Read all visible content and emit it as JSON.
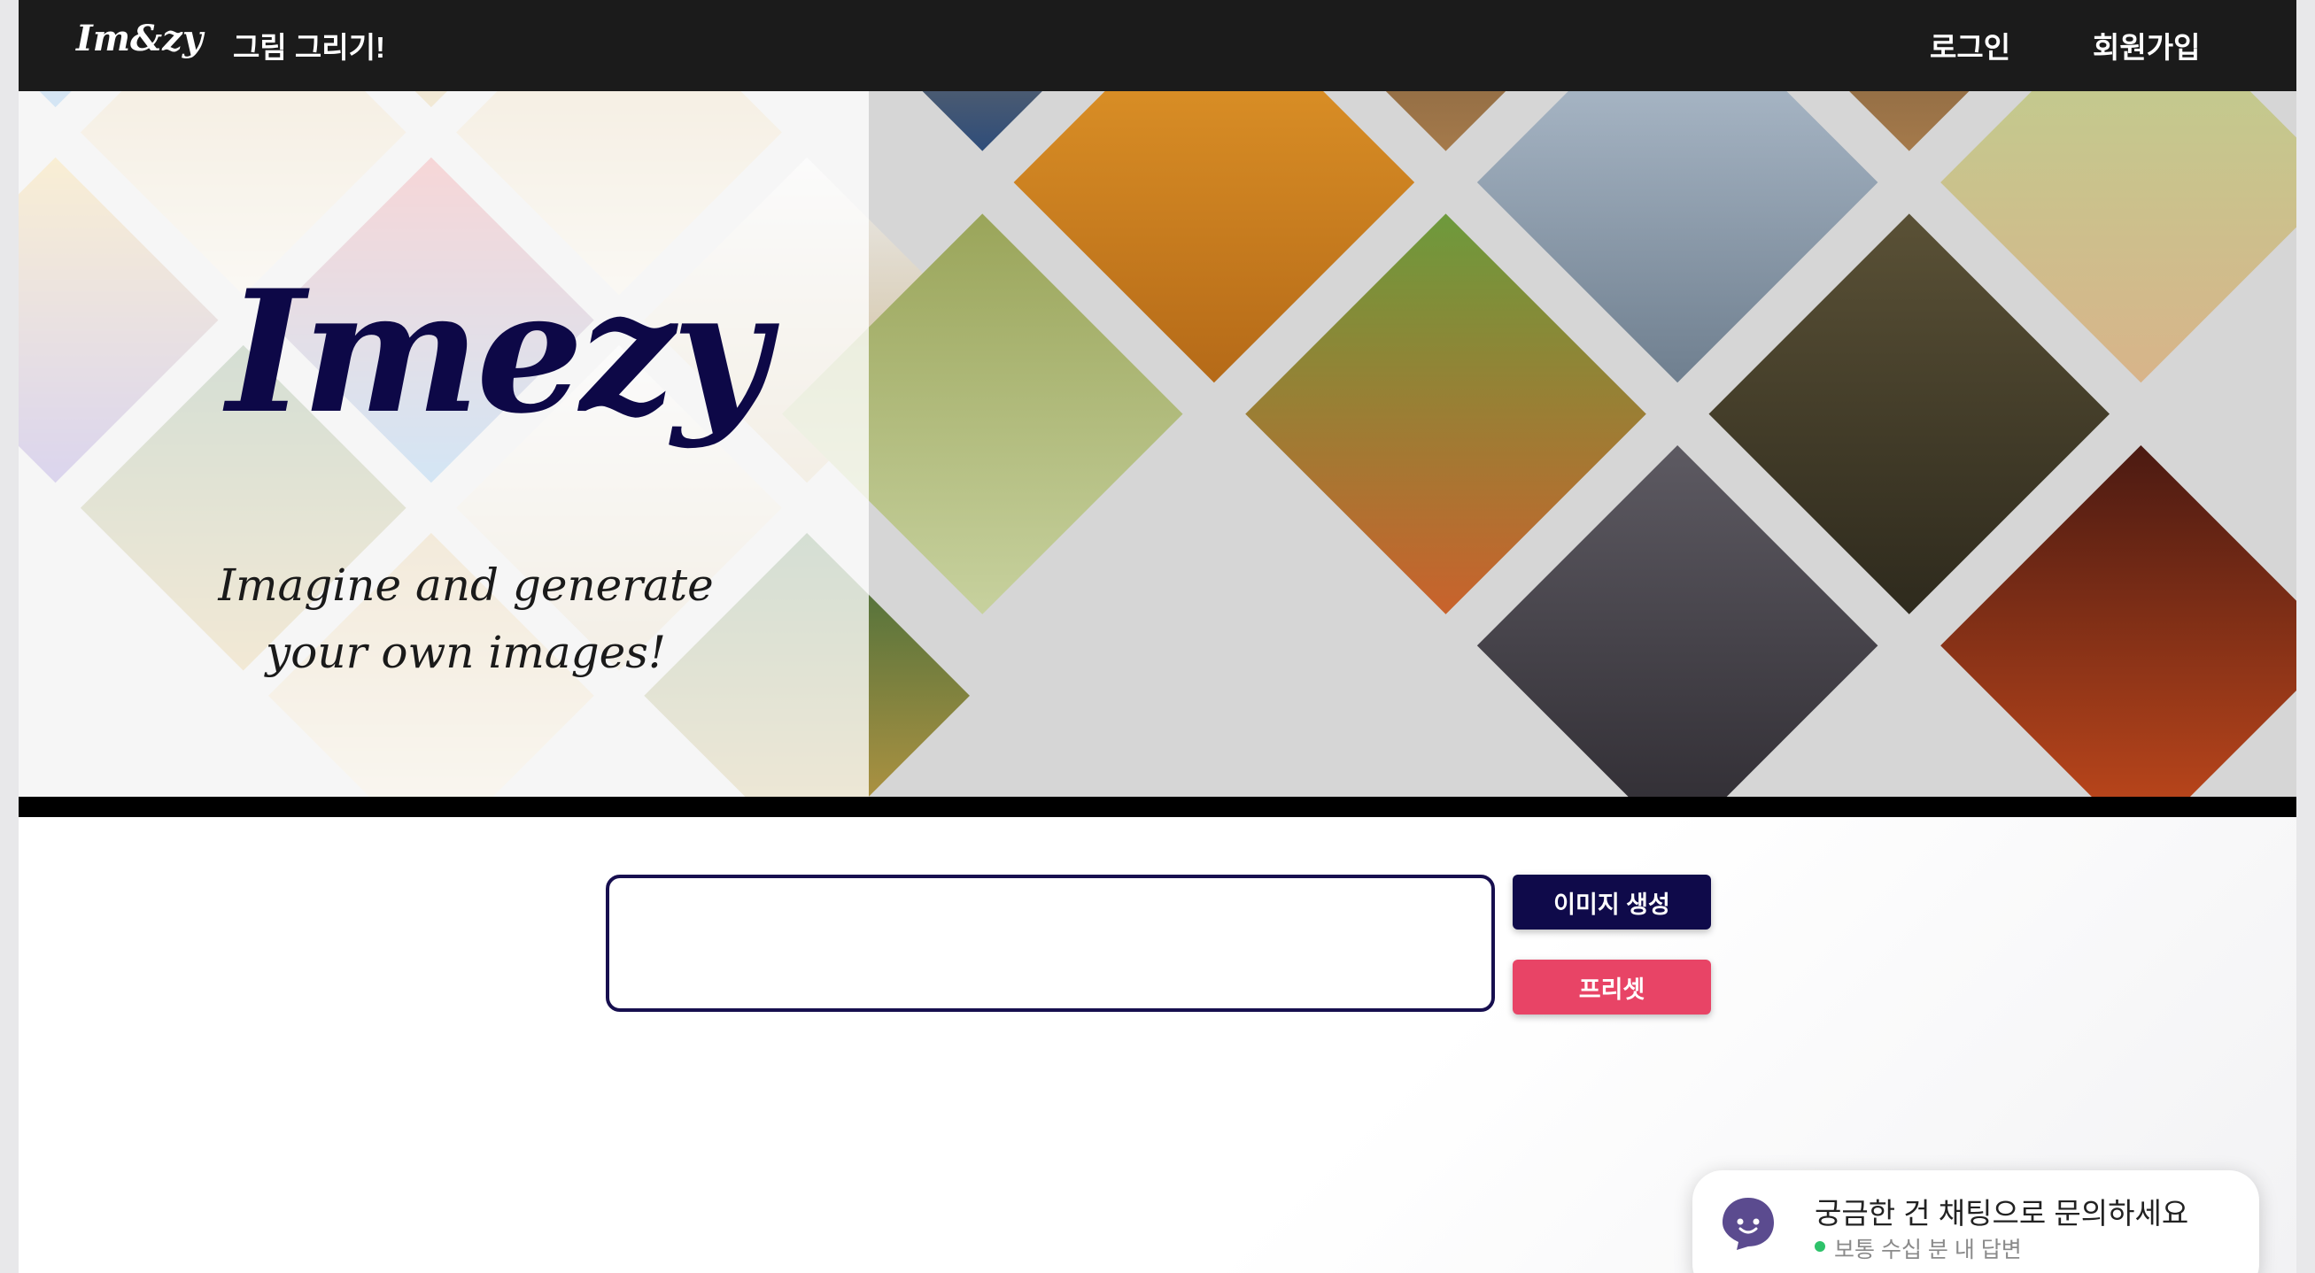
{
  "navbar": {
    "brand": "Im&zy",
    "draw_link": "그림 그리기!",
    "login": "로그인",
    "signup": "회원가입"
  },
  "hero": {
    "logo_text": "Imezy",
    "tagline_line1": "Imagine and generate",
    "tagline_line2": "your own images!"
  },
  "form": {
    "prompt_value": "",
    "prompt_placeholder": "",
    "generate_button": "이미지 생성",
    "preset_button": "프리셋"
  },
  "chat": {
    "title": "궁금한 건 채팅으로 문의하세요",
    "subtitle": "보통 수십 분 내 답변"
  },
  "colors": {
    "navbar_bg": "#1b1b1b",
    "primary": "#0f0a4a",
    "preset": "#e84466",
    "online": "#2ec26a"
  }
}
